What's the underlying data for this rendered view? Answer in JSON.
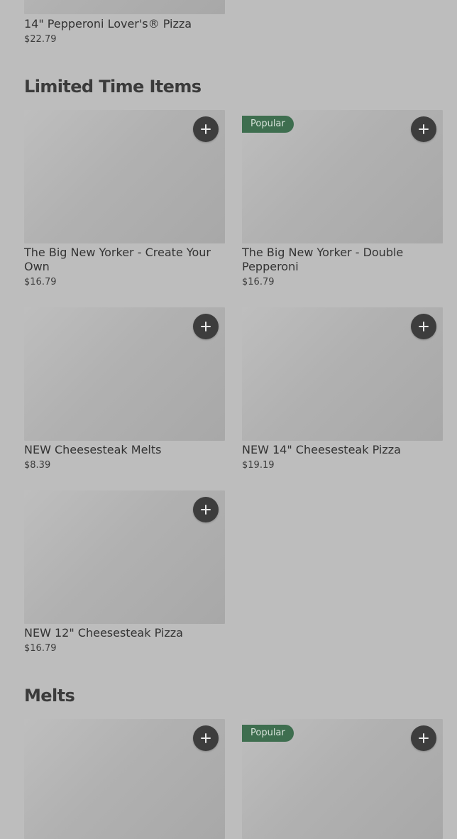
{
  "top_item": {
    "name": "14\" Pepperoni Lover's® Pizza",
    "price": "$22.79"
  },
  "sections": [
    {
      "title": "Limited Time Items",
      "items": [
        {
          "name": "The Big New Yorker - Create Your Own",
          "price": "$16.79",
          "badge": ""
        },
        {
          "name": "The Big New Yorker - Double Pepperoni",
          "price": "$16.79",
          "badge": "Popular"
        },
        {
          "name": "NEW Cheesesteak Melts",
          "price": "$8.39",
          "badge": ""
        },
        {
          "name": "NEW 14\" Cheesesteak Pizza",
          "price": "$19.19",
          "badge": ""
        },
        {
          "name": "NEW 12\" Cheesesteak Pizza",
          "price": "$16.79",
          "badge": ""
        }
      ]
    },
    {
      "title": "Melts",
      "items": [
        {
          "badge": ""
        },
        {
          "badge": "Popular"
        }
      ]
    }
  ]
}
